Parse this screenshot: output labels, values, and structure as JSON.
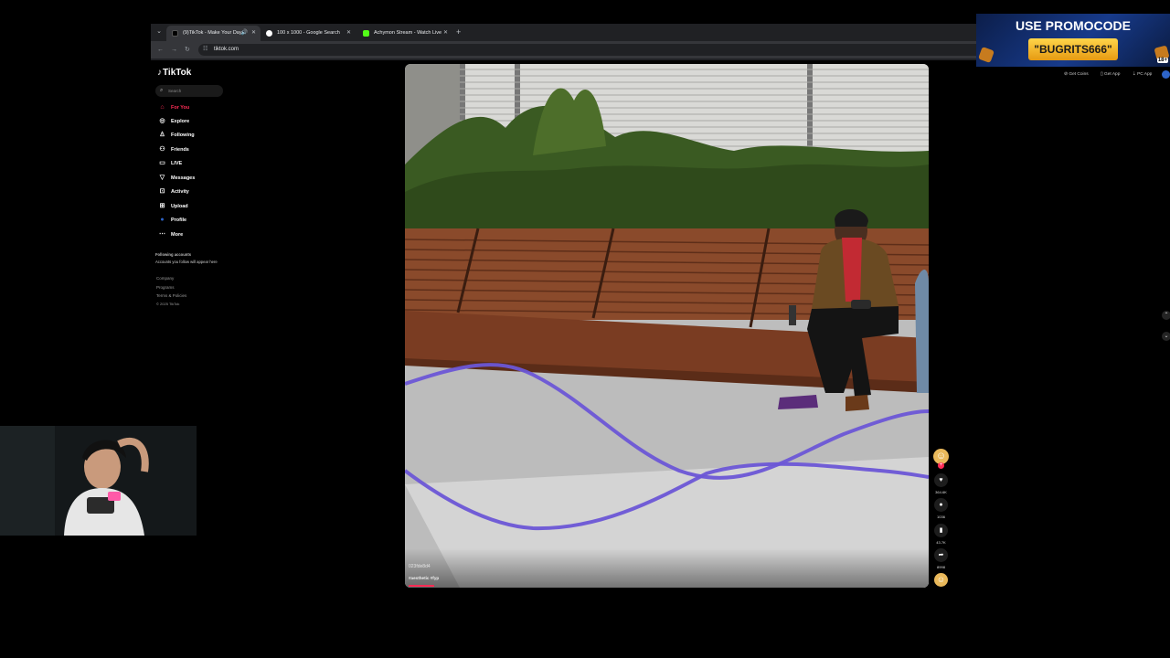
{
  "browser": {
    "tabs": [
      {
        "title": "(9)TikTok - Make Your Day",
        "active": true,
        "icon": "tiktok-favicon"
      },
      {
        "title": "100 x 1000 - Google Search",
        "active": false,
        "icon": "google-favicon"
      },
      {
        "title": "Achymon Stream - Watch Live",
        "active": false,
        "icon": "kick-favicon"
      }
    ],
    "url": "tiktok.com"
  },
  "tiktok": {
    "logo": "TikTok",
    "search_placeholder": "Search",
    "nav": [
      {
        "label": "For You",
        "icon": "home-icon",
        "active": true
      },
      {
        "label": "Explore",
        "icon": "compass-icon"
      },
      {
        "label": "Following",
        "icon": "person-follow-icon"
      },
      {
        "label": "Friends",
        "icon": "friends-icon"
      },
      {
        "label": "LIVE",
        "icon": "live-icon"
      },
      {
        "label": "Messages",
        "icon": "send-icon"
      },
      {
        "label": "Activity",
        "icon": "activity-icon"
      },
      {
        "label": "Upload",
        "icon": "plus-square-icon"
      },
      {
        "label": "Profile",
        "icon": "profile-avatar-icon"
      },
      {
        "label": "More",
        "icon": "more-icon"
      }
    ],
    "following_heading": "Following accounts",
    "following_note": "Accounts you follow will appear here",
    "footer": {
      "company": "Company",
      "programs": "Programs",
      "terms": "Terms & Policies",
      "copyright": "© 2025 TikTok"
    }
  },
  "video": {
    "username": "023fde8d4",
    "caption": "#aesthetic #fyp",
    "progress_fraction": 0.05,
    "actions": {
      "likes": "364.6K",
      "comments": "1036",
      "saves": "43.7K",
      "shares": "8998"
    }
  },
  "right_panel": {
    "links": [
      "Get Coins",
      "Get App",
      "PC App"
    ]
  },
  "ad": {
    "line1": "USE PROMOCODE",
    "code": "\"BUGRITS666\"",
    "age": "18+"
  },
  "colors": {
    "tiktok_red": "#fe2c55",
    "trail": "#6b56d6"
  }
}
